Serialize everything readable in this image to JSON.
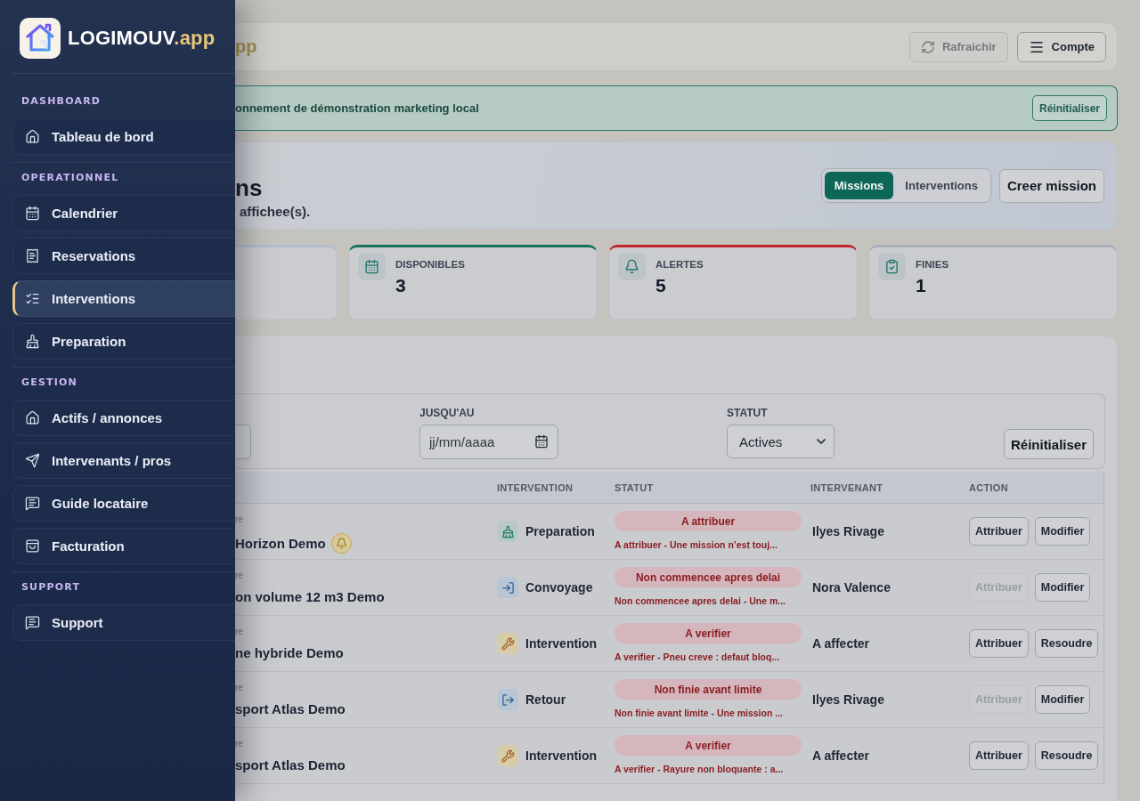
{
  "sidebar": {
    "brand": {
      "name": "LOGIMOUV",
      "suffix": ".app"
    },
    "sections": [
      {
        "title": "DASHBOARD",
        "items": [
          {
            "label": "Tableau de bord",
            "kind": "dashboard",
            "selected": false
          }
        ]
      },
      {
        "title": "OPERATIONNEL",
        "items": [
          {
            "label": "Calendrier",
            "kind": "calendar",
            "selected": false
          },
          {
            "label": "Reservations",
            "kind": "reservations",
            "selected": false
          },
          {
            "label": "Interventions",
            "kind": "interventions",
            "selected": true
          },
          {
            "label": "Preparation",
            "kind": "preparation",
            "selected": false
          }
        ]
      },
      {
        "title": "GESTION",
        "items": [
          {
            "label": "Actifs / annonces",
            "kind": "assets",
            "selected": false
          },
          {
            "label": "Intervenants / pros",
            "kind": "providers",
            "selected": false
          },
          {
            "label": "Guide locataire",
            "kind": "guide",
            "selected": false
          },
          {
            "label": "Facturation",
            "kind": "billing",
            "selected": false
          }
        ]
      },
      {
        "title": "SUPPORT",
        "items": [
          {
            "label": "Support",
            "kind": "support",
            "selected": false
          }
        ]
      }
    ]
  },
  "header": {
    "brand_fragment": "pp",
    "buttons": [
      {
        "label": "Rafraichir",
        "kind": "refresh",
        "disabled": true
      },
      {
        "label": "Compte",
        "kind": "menu",
        "disabled": false
      }
    ]
  },
  "banner": {
    "text": "onnement de démonstration marketing local",
    "button": "Réinitialiser"
  },
  "hero": {
    "title": "ns",
    "subtitle": "affichee(s).",
    "view_tabs": [
      {
        "label": "Missions",
        "selected": true
      },
      {
        "label": "Interventions",
        "selected": false
      }
    ],
    "primary_button": "Creer mission"
  },
  "stats": [
    {
      "label": "DISPONIBLES",
      "value": "3",
      "kind": "available",
      "color": "#17705f"
    },
    {
      "label": "ALERTES",
      "value": "5",
      "kind": "alert",
      "color": "#c0282d"
    },
    {
      "label": "FINIES",
      "value": "1",
      "kind": "done",
      "color": "#a9afba"
    }
  ],
  "filters": {
    "fields": [
      {
        "label": "JUSQU'AU",
        "kind": "date",
        "placeholder": "jj/mm/aaaa"
      },
      {
        "label": "STATUT",
        "kind": "select",
        "value": "Actives"
      }
    ],
    "reset_button": "Réinitialiser"
  },
  "table": {
    "columns": [
      "INTERVENTION",
      "STATUT",
      "INTERVENANT",
      "ACTION"
    ],
    "rows": [
      {
        "subtitle": "re",
        "title": "Horizon Demo",
        "alert": true,
        "intervention": {
          "kind": "preparation",
          "label": "Preparation"
        },
        "status": {
          "label": "A attribuer",
          "detail": "A attribuer - Une mission n’est touj..."
        },
        "assignee": "Ilyes Rivage",
        "actions": [
          {
            "label": "Attribuer",
            "disabled": false
          },
          {
            "label": "Modifier",
            "disabled": false
          }
        ]
      },
      {
        "subtitle": "re",
        "title": "on volume 12 m3 Demo",
        "alert": false,
        "intervention": {
          "kind": "convoyage",
          "label": "Convoyage"
        },
        "status": {
          "label": "Non commencee apres delai",
          "detail": "Non commencee apres delai - Une m..."
        },
        "assignee": "Nora Valence",
        "actions": [
          {
            "label": "Attribuer",
            "disabled": true
          },
          {
            "label": "Modifier",
            "disabled": false
          }
        ]
      },
      {
        "subtitle": "re",
        "title": "ne hybride Demo",
        "alert": false,
        "intervention": {
          "kind": "intervention",
          "label": "Intervention"
        },
        "status": {
          "label": "A verifier",
          "detail": "A verifier - Pneu creve : defaut bloq..."
        },
        "assignee": "A affecter",
        "actions": [
          {
            "label": "Attribuer",
            "disabled": false
          },
          {
            "label": "Resoudre",
            "disabled": false
          }
        ]
      },
      {
        "subtitle": "re",
        "title": "sport Atlas Demo",
        "alert": false,
        "intervention": {
          "kind": "retour",
          "label": "Retour"
        },
        "status": {
          "label": "Non finie avant limite",
          "detail": "Non finie avant limite - Une mission ..."
        },
        "assignee": "Ilyes Rivage",
        "actions": [
          {
            "label": "Attribuer",
            "disabled": true
          },
          {
            "label": "Modifier",
            "disabled": false
          }
        ]
      },
      {
        "subtitle": "re",
        "title": "sport Atlas Demo",
        "alert": false,
        "intervention": {
          "kind": "intervention",
          "label": "Intervention"
        },
        "status": {
          "label": "A verifier",
          "detail": "A verifier - Rayure non bloquante : a..."
        },
        "assignee": "A affecter",
        "actions": [
          {
            "label": "Attribuer",
            "disabled": false
          },
          {
            "label": "Resoudre",
            "disabled": false
          }
        ]
      }
    ]
  }
}
